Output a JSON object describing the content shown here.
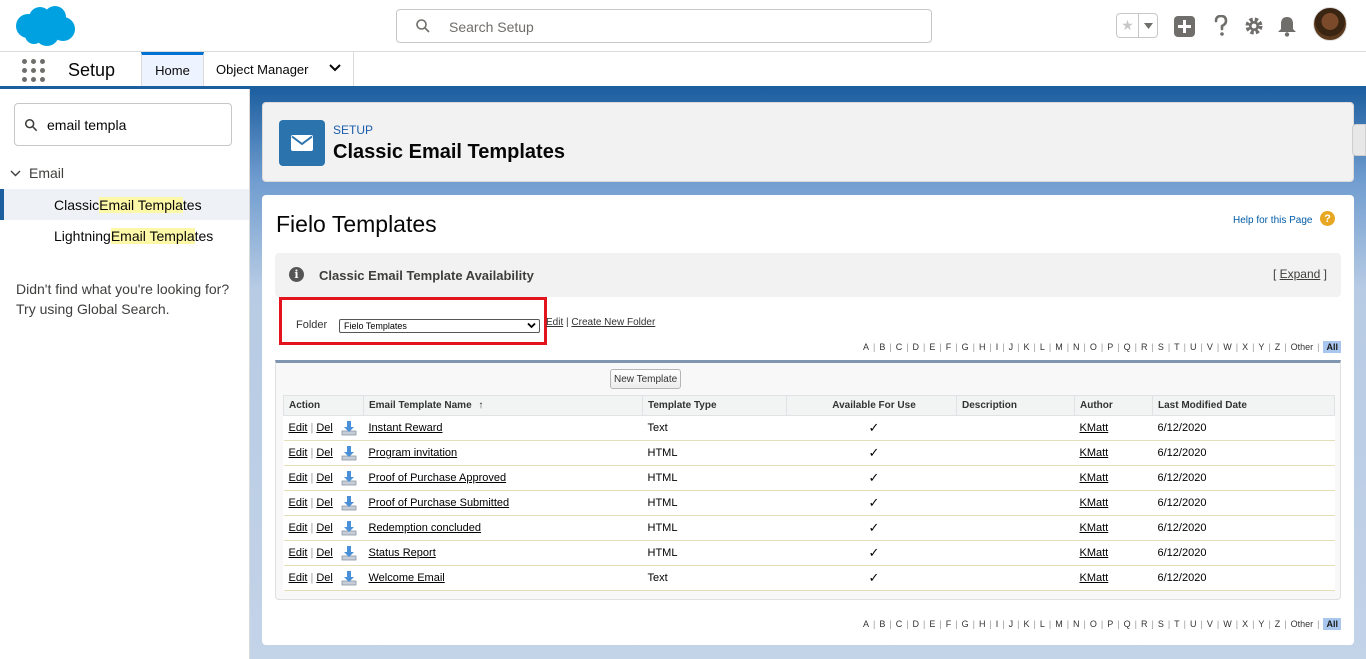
{
  "header": {
    "search_placeholder": "Search Setup"
  },
  "context_bar": {
    "app_name": "Setup",
    "tabs": [
      {
        "label": "Home"
      },
      {
        "label": "Object Manager"
      }
    ]
  },
  "sidebar": {
    "quickfind_value": "email templa",
    "node_label": "Email",
    "items": [
      {
        "pre": "Classic ",
        "match1": "Email Templa",
        "post": "tes",
        "active": true
      },
      {
        "pre": "Lightning ",
        "match1": "Email Templa",
        "post": "tes",
        "active": false
      }
    ],
    "not_found_line1": "Didn't find what you're looking for?",
    "not_found_line2": "Try using Global Search."
  },
  "setup_header": {
    "breadcrumb": "SETUP",
    "title": "Classic Email Templates"
  },
  "content": {
    "page_title": "Fielo Templates",
    "help_link": "Help for this Page",
    "availability_title": "Classic Email Template Availability",
    "expand_open": "[ ",
    "expand_label": "Expand",
    "expand_close": " ]",
    "folder_label": "Folder",
    "folder_value": "Fielo Templates",
    "edit_link": "Edit",
    "new_folder_link": "Create New Folder",
    "alphabet": [
      "A",
      "B",
      "C",
      "D",
      "E",
      "F",
      "G",
      "H",
      "I",
      "J",
      "K",
      "L",
      "M",
      "N",
      "O",
      "P",
      "Q",
      "R",
      "S",
      "T",
      "U",
      "V",
      "W",
      "X",
      "Y",
      "Z",
      "Other",
      "All"
    ],
    "new_template_button": "New Template",
    "columns": [
      "Action",
      "Email Template Name",
      "Template Type",
      "Available For Use",
      "Description",
      "Author",
      "Last Modified Date"
    ],
    "sort_indicator": "↑",
    "action_edit": "Edit",
    "action_del": "Del",
    "rows": [
      {
        "name": "Instant Reward",
        "type": "Text",
        "available": "✓",
        "description": "",
        "author": "KMatt",
        "modified": "6/12/2020"
      },
      {
        "name": "Program invitation",
        "type": "HTML",
        "available": "✓",
        "description": "",
        "author": "KMatt",
        "modified": "6/12/2020"
      },
      {
        "name": "Proof of Purchase Approved",
        "type": "HTML",
        "available": "✓",
        "description": "",
        "author": "KMatt",
        "modified": "6/12/2020"
      },
      {
        "name": "Proof of Purchase Submitted",
        "type": "HTML",
        "available": "✓",
        "description": "",
        "author": "KMatt",
        "modified": "6/12/2020"
      },
      {
        "name": "Redemption concluded",
        "type": "HTML",
        "available": "✓",
        "description": "",
        "author": "KMatt",
        "modified": "6/12/2020"
      },
      {
        "name": "Status Report",
        "type": "HTML",
        "available": "✓",
        "description": "",
        "author": "KMatt",
        "modified": "6/12/2020"
      },
      {
        "name": "Welcome Email",
        "type": "Text",
        "available": "✓",
        "description": "",
        "author": "KMatt",
        "modified": "6/12/2020"
      }
    ]
  },
  "colors": {
    "brand_blue": "#0070d2",
    "header_blue": "#1b5f9e",
    "highlight_yellow": "#fdf8a8",
    "annotation_red": "#e2151f"
  }
}
